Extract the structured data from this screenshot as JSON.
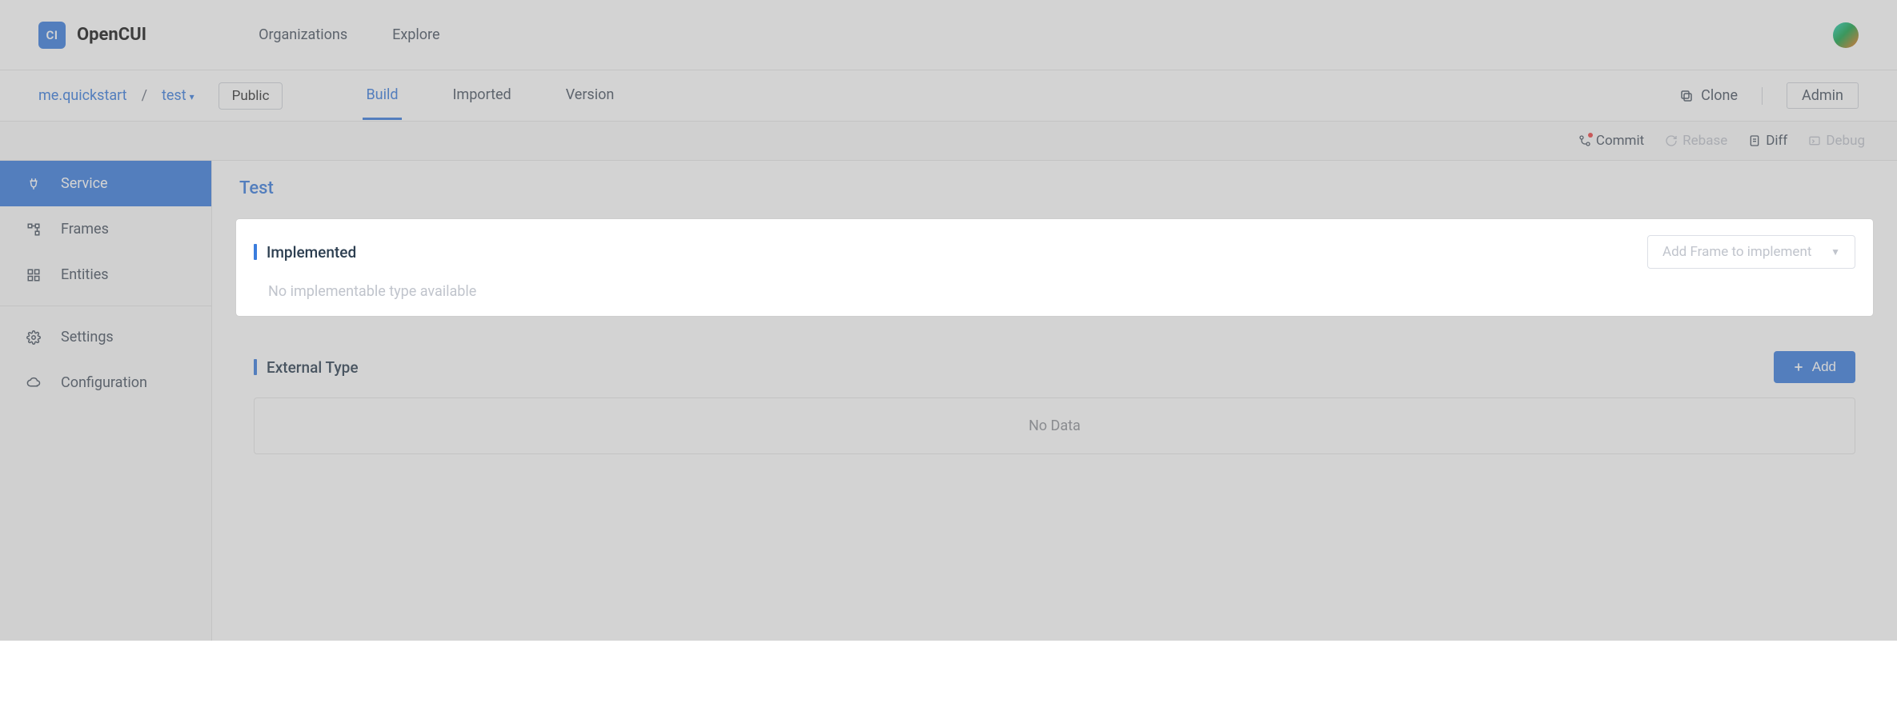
{
  "header": {
    "logo_badge": "CI",
    "logo_text": "OpenCUI",
    "nav": {
      "organizations": "Organizations",
      "explore": "Explore"
    }
  },
  "breadcrumb": {
    "org": "me.quickstart",
    "sep": "/",
    "project": "test",
    "visibility": "Public"
  },
  "tabs": {
    "build": "Build",
    "imported": "Imported",
    "version": "Version"
  },
  "actions": {
    "clone": "Clone",
    "admin": "Admin"
  },
  "toolbar": {
    "commit": "Commit",
    "rebase": "Rebase",
    "diff": "Diff",
    "debug": "Debug"
  },
  "sidebar": {
    "service": "Service",
    "frames": "Frames",
    "entities": "Entities",
    "settings": "Settings",
    "configuration": "Configuration"
  },
  "main": {
    "title": "Test",
    "implemented": {
      "heading": "Implemented",
      "select_placeholder": "Add Frame to implement",
      "empty": "No implementable type available"
    },
    "external": {
      "heading": "External Type",
      "add": "Add",
      "no_data": "No Data"
    }
  }
}
